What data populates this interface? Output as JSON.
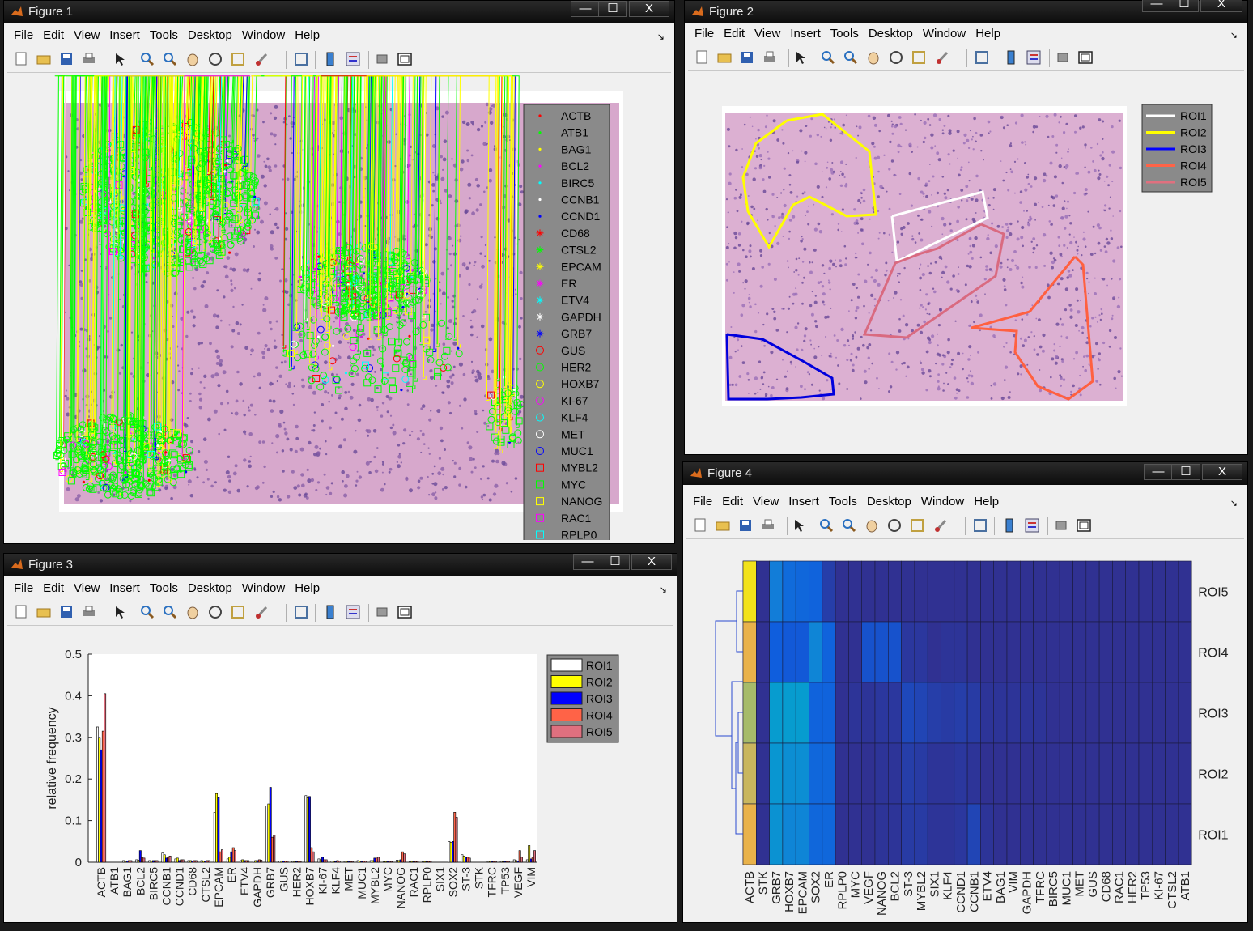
{
  "menu": [
    "File",
    "Edit",
    "View",
    "Insert",
    "Tools",
    "Desktop",
    "Window",
    "Help"
  ],
  "window_buttons": {
    "minimize": "—",
    "maximize": "☐",
    "close": "X"
  },
  "toolbar_icons": [
    "new-file-icon",
    "open-folder-icon",
    "save-icon",
    "print-icon",
    "pointer-icon",
    "zoom-in-icon",
    "zoom-out-icon",
    "pan-hand-icon",
    "rotate-3d-icon",
    "data-cursor-icon",
    "brush-icon",
    "link-plot-icon",
    "colorbar-icon",
    "legend-icon",
    "hide-plot-tools-icon",
    "show-plot-tools-icon"
  ],
  "fig1": {
    "title": "Figure 1",
    "legend": [
      {
        "label": "ACTB",
        "marker": "dot",
        "color": "#ff0000"
      },
      {
        "label": "ATB1",
        "marker": "dot",
        "color": "#00ff00"
      },
      {
        "label": "BAG1",
        "marker": "dot",
        "color": "#ffff00"
      },
      {
        "label": "BCL2",
        "marker": "dot",
        "color": "#ff00ff"
      },
      {
        "label": "BIRC5",
        "marker": "dot",
        "color": "#00ffff"
      },
      {
        "label": "CCNB1",
        "marker": "dot",
        "color": "#ffffff"
      },
      {
        "label": "CCND1",
        "marker": "dot",
        "color": "#0000ff"
      },
      {
        "label": "CD68",
        "marker": "star",
        "color": "#ff0000"
      },
      {
        "label": "CTSL2",
        "marker": "star",
        "color": "#00ff00"
      },
      {
        "label": "EPCAM",
        "marker": "star",
        "color": "#ffff00"
      },
      {
        "label": "ER",
        "marker": "star",
        "color": "#ff00ff"
      },
      {
        "label": "ETV4",
        "marker": "star",
        "color": "#00ffff"
      },
      {
        "label": "GAPDH",
        "marker": "star",
        "color": "#ffffff"
      },
      {
        "label": "GRB7",
        "marker": "star",
        "color": "#0000ff"
      },
      {
        "label": "GUS",
        "marker": "circle",
        "color": "#ff0000"
      },
      {
        "label": "HER2",
        "marker": "circle",
        "color": "#00ff00"
      },
      {
        "label": "HOXB7",
        "marker": "circle",
        "color": "#ffff00"
      },
      {
        "label": "KI-67",
        "marker": "circle",
        "color": "#ff00ff"
      },
      {
        "label": "KLF4",
        "marker": "circle",
        "color": "#00ffff"
      },
      {
        "label": "MET",
        "marker": "circle",
        "color": "#ffffff"
      },
      {
        "label": "MUC1",
        "marker": "circle",
        "color": "#0000ff"
      },
      {
        "label": "MYBL2",
        "marker": "square",
        "color": "#ff0000"
      },
      {
        "label": "MYC",
        "marker": "square",
        "color": "#00ff00"
      },
      {
        "label": "NANOG",
        "marker": "square",
        "color": "#ffff00"
      },
      {
        "label": "RAC1",
        "marker": "square",
        "color": "#ff00ff"
      },
      {
        "label": "RPLP0",
        "marker": "square",
        "color": "#00ffff"
      }
    ]
  },
  "fig2": {
    "title": "Figure 2",
    "legend": [
      {
        "label": "ROI1",
        "color": "#ffffff"
      },
      {
        "label": "ROI2",
        "color": "#ffff00"
      },
      {
        "label": "ROI3",
        "color": "#0000ff"
      },
      {
        "label": "ROI4",
        "color": "#ff6347"
      },
      {
        "label": "ROI5",
        "color": "#e0707f"
      }
    ]
  },
  "fig3": {
    "title": "Figure 3",
    "legend": [
      {
        "label": "ROI1",
        "color": "#ffffff"
      },
      {
        "label": "ROI2",
        "color": "#ffff00"
      },
      {
        "label": "ROI3",
        "color": "#0000ff"
      },
      {
        "label": "ROI4",
        "color": "#ff6347"
      },
      {
        "label": "ROI5",
        "color": "#e0707f"
      }
    ]
  },
  "fig4": {
    "title": "Figure 4",
    "row_labels": [
      "ROI5",
      "ROI4",
      "ROI3",
      "ROI2",
      "ROI1"
    ],
    "col_labels": [
      "ACTB",
      "STK",
      "GRB7",
      "HOXB7",
      "EPCAM",
      "SOX2",
      "ER",
      "RPLP0",
      "MYC",
      "VEGF",
      "NANOG",
      "BCL2",
      "ST-3",
      "MYBL2",
      "SIX1",
      "KLF4",
      "CCND1",
      "CCNB1",
      "ETV4",
      "BAG1",
      "VIM",
      "GAPDH",
      "TFRC",
      "BIRC5",
      "MUC1",
      "MET",
      "GUS",
      "CD68",
      "RAC1",
      "HER2",
      "TP53",
      "KI-67",
      "CTSL2",
      "ATB1"
    ],
    "row_colors": [
      "#f2e21b",
      "#e9b24a",
      "#a6bb6a",
      "#c9b65e",
      "#e9b24a"
    ]
  },
  "chart_data": [
    {
      "type": "bar",
      "ylabel": "relative frequency",
      "ylim": [
        0,
        0.5
      ],
      "yticks": [
        "0",
        "0.1",
        "0.2",
        "0.3",
        "0.4",
        "0.5"
      ],
      "categories": [
        "ACTB",
        "ATB1",
        "BAG1",
        "BCL2",
        "BIRC5",
        "CCNB1",
        "CCND1",
        "CD68",
        "CTSL2",
        "EPCAM",
        "ER",
        "ETV4",
        "GAPDH",
        "GRB7",
        "GUS",
        "HER2",
        "HOXB7",
        "KI-67",
        "KLF4",
        "MET",
        "MUC1",
        "MYBL2",
        "MYC",
        "NANOG",
        "RAC1",
        "RPLP0",
        "SIX1",
        "SOX2",
        "ST-3",
        "STK",
        "TFRC",
        "TP53",
        "VEGF",
        "VIM"
      ],
      "series": [
        {
          "name": "ROI1",
          "color": "#ffffff",
          "values": [
            0.325,
            0,
            0.004,
            0.006,
            0.004,
            0.022,
            0.008,
            0.004,
            0.004,
            0.12,
            0.008,
            0.004,
            0.003,
            0.135,
            0.003,
            0.002,
            0.16,
            0.008,
            0.003,
            0.002,
            0.004,
            0.004,
            0.002,
            0.005,
            0.002,
            0.002,
            0,
            0.05,
            0.018,
            0,
            0.002,
            0.002,
            0.006,
            0.006
          ]
        },
        {
          "name": "ROI2",
          "color": "#ffff00",
          "values": [
            0.3,
            0,
            0.003,
            0.005,
            0.003,
            0.018,
            0.01,
            0.004,
            0.003,
            0.165,
            0.012,
            0.006,
            0.004,
            0.14,
            0.003,
            0.002,
            0.155,
            0.006,
            0.002,
            0.002,
            0.003,
            0.004,
            0.002,
            0.004,
            0.002,
            0.002,
            0,
            0.048,
            0.015,
            0,
            0.002,
            0.002,
            0.004,
            0.04
          ]
        },
        {
          "name": "ROI3",
          "color": "#0000ff",
          "values": [
            0.27,
            0,
            0.003,
            0.028,
            0.004,
            0.01,
            0.004,
            0.003,
            0.003,
            0.155,
            0.025,
            0.004,
            0.004,
            0.18,
            0.003,
            0.002,
            0.158,
            0.012,
            0.002,
            0.002,
            0.002,
            0.01,
            0.002,
            0.006,
            0.002,
            0.002,
            0,
            0.05,
            0.012,
            0,
            0.002,
            0.002,
            0.003,
            0.008
          ]
        },
        {
          "name": "ROI4",
          "color": "#ff6347",
          "values": [
            0.315,
            0,
            0.004,
            0.012,
            0.004,
            0.012,
            0.006,
            0.004,
            0.004,
            0.025,
            0.035,
            0.004,
            0.006,
            0.06,
            0.003,
            0.002,
            0.035,
            0.006,
            0.004,
            0.002,
            0.003,
            0.01,
            0.002,
            0.025,
            0.002,
            0.002,
            0,
            0.12,
            0.012,
            0,
            0.002,
            0.002,
            0.028,
            0.012
          ]
        },
        {
          "name": "ROI5",
          "color": "#e0707f",
          "values": [
            0.405,
            0,
            0.004,
            0.01,
            0.004,
            0.015,
            0.006,
            0.004,
            0.004,
            0.03,
            0.028,
            0.004,
            0.005,
            0.065,
            0.003,
            0.002,
            0.025,
            0.006,
            0.003,
            0.002,
            0.003,
            0.012,
            0.002,
            0.02,
            0.002,
            0.002,
            0,
            0.108,
            0.01,
            0,
            0.002,
            0.002,
            0.012,
            0.028
          ]
        }
      ]
    },
    {
      "type": "heatmap",
      "rows": [
        "ROI5",
        "ROI4",
        "ROI3",
        "ROI2",
        "ROI1"
      ],
      "cols": [
        "ACTB",
        "STK",
        "GRB7",
        "HOXB7",
        "EPCAM",
        "SOX2",
        "ER",
        "RPLP0",
        "MYC",
        "VEGF",
        "NANOG",
        "BCL2",
        "ST-3",
        "MYBL2",
        "SIX1",
        "KLF4",
        "CCND1",
        "CCNB1",
        "ETV4",
        "BAG1",
        "VIM",
        "GAPDH",
        "TFRC",
        "BIRC5",
        "MUC1",
        "MET",
        "GUS",
        "CD68",
        "RAC1",
        "HER2",
        "TP53",
        "KI-67",
        "CTSL2",
        "ATB1"
      ],
      "values": [
        [
          1.0,
          0.02,
          0.3,
          0.22,
          0.2,
          0.18,
          0.06,
          0.02,
          0.02,
          0.02,
          0.02,
          0.02,
          0.02,
          0.02,
          0.02,
          0.02,
          0.02,
          0.02,
          0.02,
          0.02,
          0.02,
          0.02,
          0.02,
          0.02,
          0.02,
          0.02,
          0.02,
          0.02,
          0.02,
          0.02,
          0.02,
          0.02,
          0.02,
          0.02
        ],
        [
          0.75,
          0.02,
          0.16,
          0.14,
          0.14,
          0.34,
          0.18,
          0.02,
          0.02,
          0.12,
          0.12,
          0.12,
          0.04,
          0.04,
          0.02,
          0.03,
          0.03,
          0.02,
          0.02,
          0.02,
          0.02,
          0.02,
          0.02,
          0.02,
          0.02,
          0.02,
          0.02,
          0.02,
          0.02,
          0.02,
          0.02,
          0.02,
          0.02,
          0.02
        ],
        [
          0.68,
          0.02,
          0.45,
          0.45,
          0.45,
          0.18,
          0.18,
          0.02,
          0.03,
          0.03,
          0.04,
          0.04,
          0.09,
          0.08,
          0.06,
          0.05,
          0.06,
          0.05,
          0.03,
          0.03,
          0.03,
          0.03,
          0.03,
          0.02,
          0.02,
          0.02,
          0.02,
          0.02,
          0.02,
          0.02,
          0.02,
          0.02,
          0.02,
          0.02
        ],
        [
          0.72,
          0.02,
          0.42,
          0.38,
          0.38,
          0.2,
          0.2,
          0.02,
          0.02,
          0.02,
          0.03,
          0.03,
          0.06,
          0.05,
          0.03,
          0.03,
          0.04,
          0.03,
          0.02,
          0.02,
          0.02,
          0.02,
          0.02,
          0.02,
          0.02,
          0.02,
          0.02,
          0.02,
          0.02,
          0.02,
          0.02,
          0.02,
          0.02,
          0.02
        ],
        [
          0.74,
          0.02,
          0.4,
          0.34,
          0.34,
          0.2,
          0.2,
          0.02,
          0.02,
          0.02,
          0.03,
          0.03,
          0.05,
          0.05,
          0.03,
          0.03,
          0.04,
          0.08,
          0.03,
          0.02,
          0.02,
          0.02,
          0.02,
          0.02,
          0.02,
          0.02,
          0.02,
          0.02,
          0.02,
          0.02,
          0.02,
          0.02,
          0.02,
          0.02
        ]
      ]
    }
  ]
}
